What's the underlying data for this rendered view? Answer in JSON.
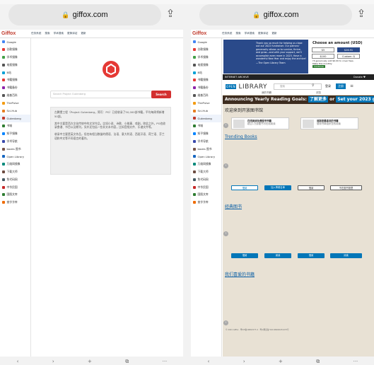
{
  "left": {
    "url": "giffox.com",
    "logo": "Giffox",
    "top_links": [
      "任务系统",
      "搜索",
      "学术搜索",
      "更换译站",
      "更新"
    ],
    "sidebar": [
      "Google",
      "谷歌镜像",
      "学术镜像",
      "电报镜像",
      "B站",
      "书籍镜像",
      "书籍备份",
      "维基百科",
      "ThePulse",
      "Sci-Hub",
      "Gutenberg",
      "书城",
      "知乎镜像",
      "学术导航",
      "books 图书",
      "Open Library",
      "万维网镜像",
      "下载大师",
      "免代码网",
      "中华民国",
      "国图文库",
      "查字字库"
    ],
    "search_placeholder": "Search Project Gutenberg",
    "search_button": "Search",
    "paragraphs": [
      "古腾堡工程（Project Gutenberg，简写：PG）已经收录了50,000部书籍，平均每周将新增50部。",
      "其中主要是西方文化传统中的文学作品，比如小说、诗歌、小故事、戏剧，除此之外，PG也收录食谱、书目以及期刊，另外还包括一些非文本内容，比如音频文件、乐谱文件等。",
      "收录中主要是英文作品，但也有相当数量的德语、法语、意大利语、西班牙语、荷兰语、芬兰语和中文等不同语言的著作。"
    ],
    "bottom": [
      "‹",
      "›",
      "+",
      "⧉",
      "···"
    ]
  },
  "right": {
    "url": "giffox.com",
    "logo": "Giffox",
    "top_links": [
      "任务系统",
      "搜索",
      "学术搜索",
      "更换译站",
      "更新"
    ],
    "sidebar": [
      "Google",
      "谷歌镜像",
      "学术镜像",
      "电报镜像",
      "B站",
      "书籍镜像",
      "书籍备份",
      "维基百科",
      "ThePulse",
      "Sci-Hub",
      "Gutenberg",
      "书城",
      "知乎镜像",
      "学术导航",
      "books 图书",
      "Open Library",
      "万维网镜像",
      "下载大师",
      "免代码网",
      "中华民国",
      "国图文库",
      "查字字库"
    ],
    "donate_text": "Thank you so much for helping us close out our 2022 fundraiser. Our patrons' generosity allows us to survive, thrive, and grow—and with your support, we'll accomplish even more in 2023. Have a wonderful New Year and enjoy the archive!",
    "donate_sign": "—The Open Library Team",
    "donate_title": "Choose an amount (USD)",
    "amounts": [
      "$5",
      "$26.91",
      "$100",
      "Custom: $"
    ],
    "donate_check1": "I'll generously add $0.00 to cover fees.",
    "donate_check2": "Make this monthly",
    "donate_continue": "Continue",
    "ia_bar": "INTERNET ARCHIVE",
    "ia_donate": "Donate ♥",
    "ol_brand": "LIBRARY",
    "ol_brand_prefix": "OPEN",
    "search_placeholder": "搜索",
    "login": "登录",
    "register": "注册",
    "mybooks": "我的书籍",
    "browse": "浏览",
    "banner": "Announcing Yearly Reading Goals:",
    "banner_learn": "了解更多",
    "banner_or": "or",
    "banner_set": "Set your 2023 goal",
    "welcome": "欢迎来到开放图书馆",
    "card1_title": "在线阅读免费图书书籍",
    "card1_desc": "超过1万部图书可在线阅读",
    "card2_title": "追踪您最喜欢的书籍",
    "card2_desc": "使用书单组织您的阅读",
    "trending": "Trending Books",
    "tr_buttons": [
      "借阅",
      "加入等候名单",
      "借阅",
      "不在图书馆里"
    ],
    "classics": "经典图书",
    "cl_buttons": [
      "借阅",
      "阅读",
      "借阅",
      "阅读"
    ],
    "favorites": "我们喜爱的书籍",
    "footer": "© 2021 Giffox · 粤ICP备19061577-2 · 粤公网安备 510109020231473号",
    "bottom": [
      "‹",
      "›",
      "+",
      "⧉",
      "···"
    ]
  }
}
